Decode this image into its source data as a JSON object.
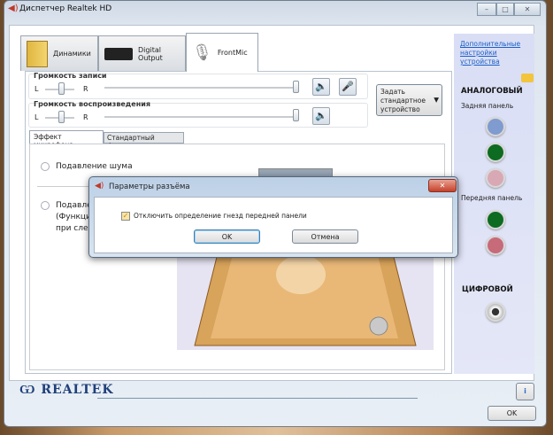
{
  "window": {
    "title": "Диспетчер Realtek HD",
    "minimize": "–",
    "maximize": "□",
    "close": "✕"
  },
  "tabs": [
    {
      "label": "Динамики"
    },
    {
      "label": "Digital Output"
    },
    {
      "label": "FrontMic"
    }
  ],
  "record_volume": {
    "label": "Громкость записи",
    "left": "L",
    "right": "R",
    "balance": 0.5,
    "level": 1.0
  },
  "playback_volume": {
    "label": "Громкость воспроизведения",
    "left": "L",
    "right": "R",
    "balance": 0.5,
    "level": 1.0
  },
  "set_default": {
    "label": "Задать стандартное устройство"
  },
  "subtabs": [
    {
      "label": "Эффект микрофона"
    },
    {
      "label": "Стандартный формат"
    }
  ],
  "effects": {
    "noise": "Подавление шума",
    "echo_1": "Подавле",
    "echo_2": "(Функци",
    "echo_3": "при след"
  },
  "right_panel": {
    "link": "Дополнительные настройки устройства",
    "analog": "АНАЛОГОВЫЙ",
    "rear": "Задняя панель",
    "front": "Передняя панель",
    "digital": "ЦИФРОВОЙ"
  },
  "dialog": {
    "title": "Параметры разъёма",
    "checkbox_label": "Отключить определение гнезд передней панели",
    "checked": true,
    "ok": "OK",
    "cancel": "Отмена",
    "close": "✕"
  },
  "footer": {
    "brand": "REALTEK",
    "info": "i",
    "ok": "OK"
  },
  "colors": {
    "jack_blue": "#7f9bd0",
    "jack_green": "#0d6b22",
    "jack_pink": "#d9a8b5",
    "jack_pink2": "#c76a7a"
  }
}
